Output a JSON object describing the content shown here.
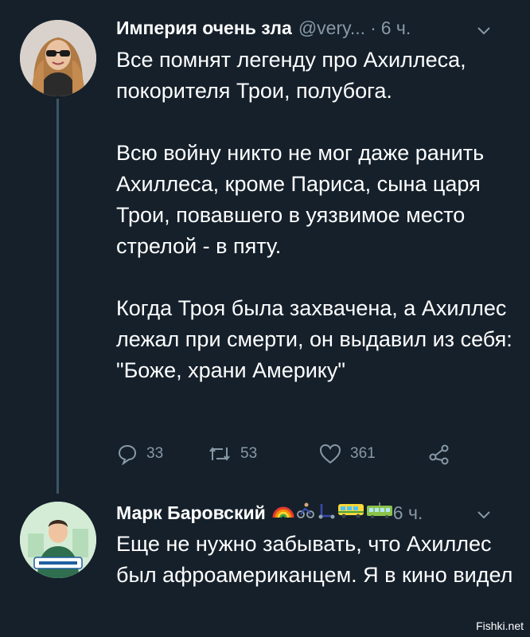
{
  "tweet1": {
    "name": "Империя очень зла",
    "handle": "@very...",
    "separator": "·",
    "time": "6 ч.",
    "paragraphs": [
      "Все помнят легенду про Ахиллеса, покорителя Трои, полубога.",
      "Всю войну никто не мог даже ранить Ахиллеса, кроме Париса, сына царя Трои, повавшего в уязвимое место стрелой - в пяту.",
      "Когда Троя была захвачена, а Ахиллес лежал при смерти, он выдавил из себя: \"Боже, храни Америку\""
    ],
    "actions": {
      "replies": "33",
      "retweets": "53",
      "likes": "361"
    }
  },
  "tweet2": {
    "name": "Марк Баровский",
    "emojis": [
      "rainbow",
      "cyclist",
      "scooter",
      "bus",
      "tram"
    ],
    "time": "6 ч.",
    "text": "Еще не нужно забывать, что Ахиллес был афроамериканцем.  Я в кино видел"
  },
  "watermark": "Fishki.net",
  "colors": {
    "background": "#15202b",
    "text": "#ffffff",
    "muted": "#8899a6",
    "thread_line": "#3d5466"
  }
}
